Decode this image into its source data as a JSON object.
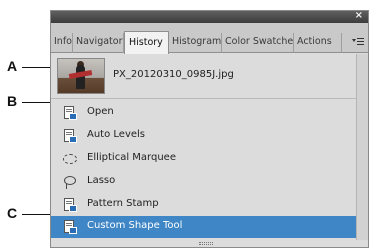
{
  "callouts": {
    "a": "A",
    "b": "B",
    "c": "C"
  },
  "panel": {
    "close_glyph": "×",
    "menu_icon": "panel-menu-icon"
  },
  "tabs": [
    {
      "label": "Info"
    },
    {
      "label": "Navigator"
    },
    {
      "label": "History"
    },
    {
      "label": "Histogram"
    },
    {
      "label": "Color Swatches"
    },
    {
      "label": "Actions"
    }
  ],
  "active_tab": "History",
  "history": {
    "snapshot": {
      "label": "PX_20120310_0985J.jpg",
      "icon": "photo-thumbnail"
    },
    "steps": [
      {
        "label": "Open",
        "icon": "document-icon"
      },
      {
        "label": "Auto Levels",
        "icon": "document-icon"
      },
      {
        "label": "Elliptical Marquee",
        "icon": "elliptical-marquee-icon"
      },
      {
        "label": "Lasso",
        "icon": "lasso-icon"
      },
      {
        "label": "Pattern Stamp",
        "icon": "document-icon"
      },
      {
        "label": "Custom Shape Tool",
        "icon": "document-icon"
      }
    ],
    "selected_step": "Custom Shape Tool"
  },
  "colors": {
    "selection": "#3f86c6",
    "panel_bg": "#dcdcdc",
    "tab_bg": "#c9c9c9"
  }
}
